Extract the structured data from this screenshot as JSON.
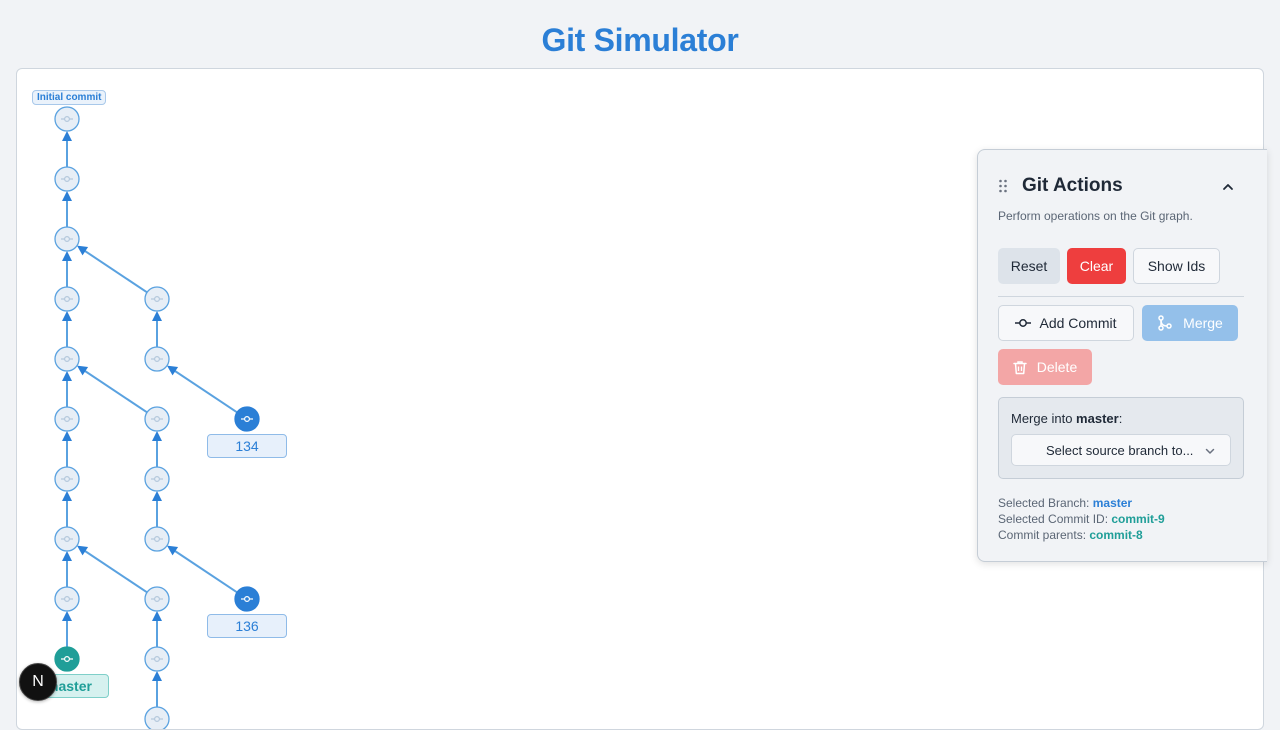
{
  "app": {
    "title": "Git Simulator"
  },
  "graph": {
    "initial_commit_label": "Initial commit",
    "branch_labels": {
      "b134": "134",
      "b136": "136",
      "master": "master"
    }
  },
  "panel": {
    "title": "Git Actions",
    "description": "Perform operations on the Git graph.",
    "buttons": {
      "reset": "Reset",
      "clear": "Clear",
      "show_ids": "Show Ids",
      "add_commit": "Add Commit",
      "merge": "Merge",
      "delete": "Delete"
    },
    "merge": {
      "label_prefix": "Merge into ",
      "target": "master",
      "label_suffix": ":",
      "select_placeholder": "Select source branch to..."
    },
    "info": {
      "branch_label": "Selected Branch: ",
      "branch_value": "master",
      "commit_label": "Selected Commit ID: ",
      "commit_value": "commit-9",
      "parents_label": "Commit parents: ",
      "parents_value": "commit-8"
    }
  },
  "badge": {
    "letter": "N"
  },
  "colors": {
    "accent": "#2b7fd6",
    "danger": "#ee3e3e",
    "teal": "#1f9e98",
    "node_fill": "#e7eef6",
    "edge": "#5aa2e0"
  }
}
